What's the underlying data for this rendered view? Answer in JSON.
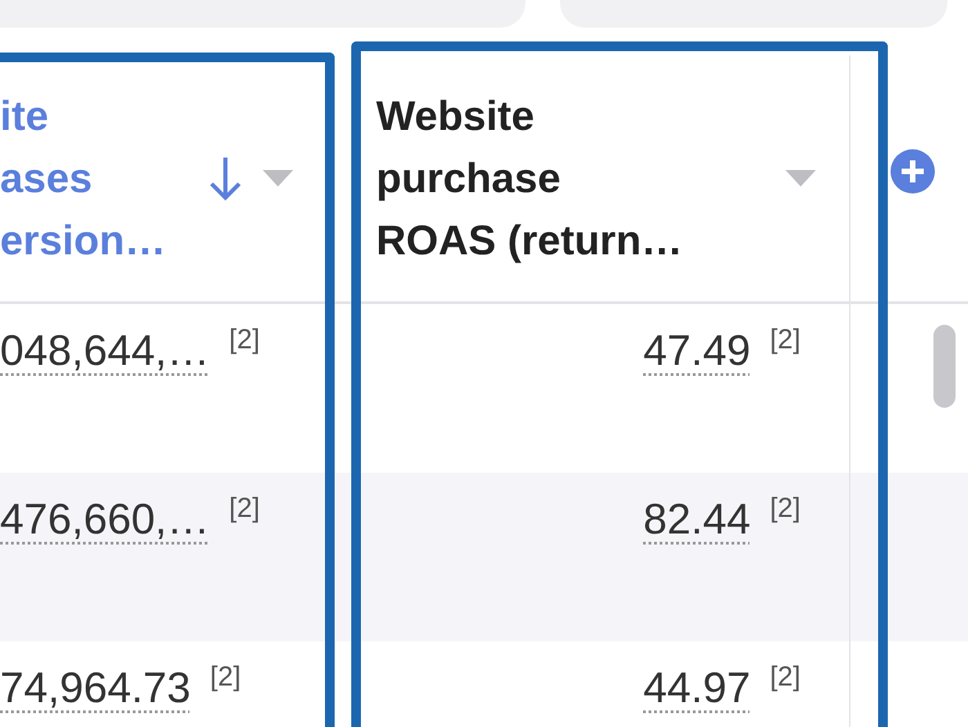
{
  "columns": [
    {
      "header_lines": [
        "ite",
        "ases",
        "ersion…"
      ],
      "sorted_descending": true,
      "highlighted": true
    },
    {
      "header_lines": [
        "Website",
        "purchase",
        "ROAS (return…"
      ],
      "sorted_descending": false,
      "highlighted": true
    }
  ],
  "rows": [
    {
      "cells": [
        {
          "value": "048,644,…",
          "note": "[2]"
        },
        {
          "value": "47.49",
          "note": "[2]"
        }
      ]
    },
    {
      "cells": [
        {
          "value": "476,660,…",
          "note": "[2]"
        },
        {
          "value": "82.44",
          "note": "[2]"
        }
      ]
    },
    {
      "cells": [
        {
          "value": "74,964.73",
          "note": "[2]"
        },
        {
          "value": "44.97",
          "note": "[2]"
        }
      ]
    }
  ]
}
